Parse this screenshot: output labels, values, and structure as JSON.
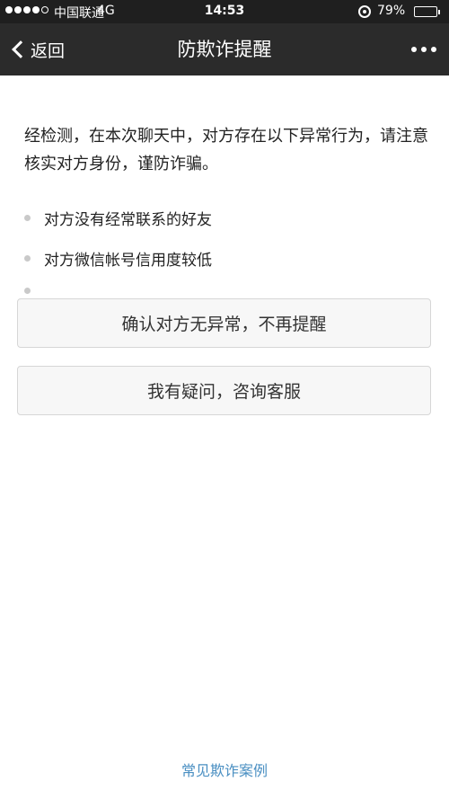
{
  "status_bar": {
    "carrier": "中国联通",
    "network": "4G",
    "time": "14:53",
    "battery": "79%",
    "battery_level": 0.79
  },
  "nav": {
    "back_label": "返回",
    "title": "防欺诈提醒"
  },
  "main": {
    "notice": "经检测，在本次聊天中，对方存在以下异常行为，请注意核实对方身份，谨防诈骗。",
    "reasons": [
      "对方没有经常联系的好友",
      "对方微信帐号信用度较低"
    ],
    "confirm_button": "确认对方无异常，不再提醒",
    "inquiry_button": "我有疑问，咨询客服"
  },
  "footer": {
    "link": "常见欺诈案例"
  },
  "colors": {
    "nav_background": "#2b2b2b",
    "link": "#4a8fc2"
  }
}
